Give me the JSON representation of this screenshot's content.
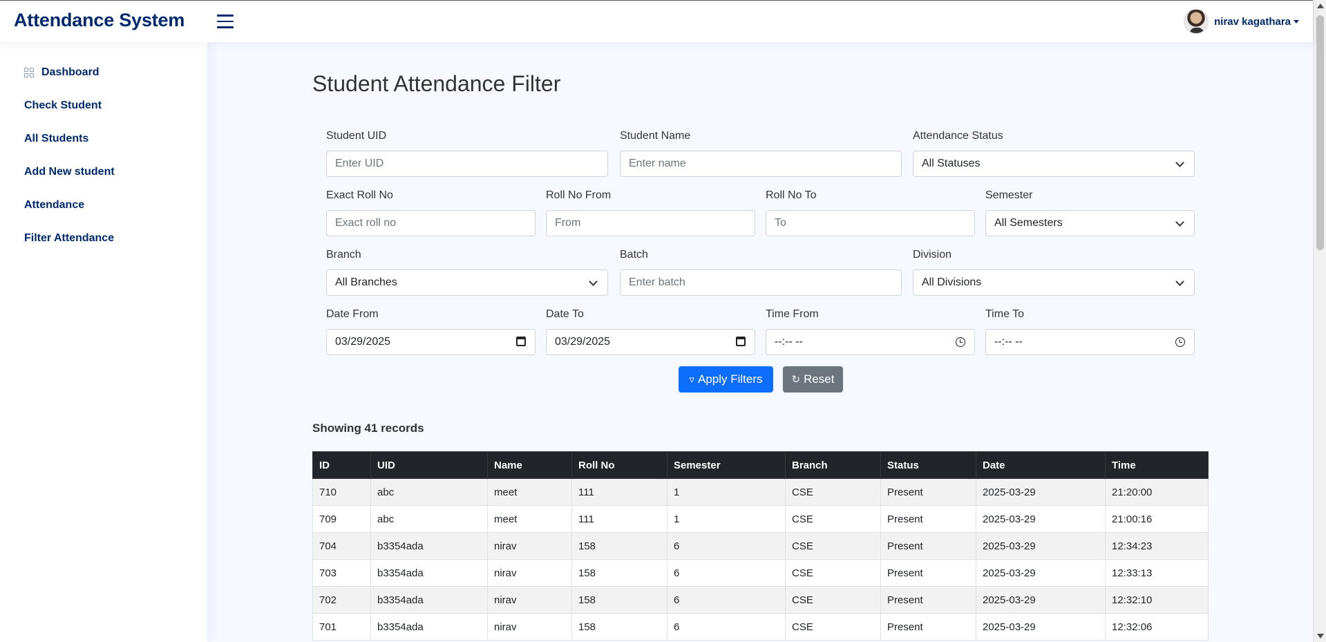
{
  "header": {
    "brand": "Attendance System",
    "user_name": "nirav kagathara"
  },
  "sidebar": {
    "items": [
      {
        "label": "Dashboard",
        "icon": "grid-icon"
      },
      {
        "label": "Check Student"
      },
      {
        "label": "All Students"
      },
      {
        "label": "Add New student"
      },
      {
        "label": "Attendance"
      },
      {
        "label": "Filter Attendance"
      }
    ]
  },
  "main": {
    "title": "Student Attendance Filter",
    "filters": {
      "uid": {
        "label": "Student UID",
        "placeholder": "Enter UID"
      },
      "name": {
        "label": "Student Name",
        "placeholder": "Enter name"
      },
      "status": {
        "label": "Attendance Status",
        "value": "All Statuses"
      },
      "exact_roll": {
        "label": "Exact Roll No",
        "placeholder": "Exact roll no"
      },
      "roll_from": {
        "label": "Roll No From",
        "placeholder": "From"
      },
      "roll_to": {
        "label": "Roll No To",
        "placeholder": "To"
      },
      "semester": {
        "label": "Semester",
        "value": "All Semesters"
      },
      "branch": {
        "label": "Branch",
        "value": "All Branches"
      },
      "batch": {
        "label": "Batch",
        "placeholder": "Enter batch"
      },
      "division": {
        "label": "Division",
        "value": "All Divisions"
      },
      "date_from": {
        "label": "Date From",
        "value": "03/29/2025"
      },
      "date_to": {
        "label": "Date To",
        "value": "03/29/2025"
      },
      "time_from": {
        "label": "Time From",
        "value": "--:-- --"
      },
      "time_to": {
        "label": "Time To",
        "value": "--:-- --"
      }
    },
    "apply_label": "Apply Filters",
    "reset_label": "Reset",
    "records_text": "Showing 41 records",
    "table": {
      "columns": [
        "ID",
        "UID",
        "Name",
        "Roll No",
        "Semester",
        "Branch",
        "Status",
        "Date",
        "Time"
      ],
      "rows": [
        [
          "710",
          "abc",
          "meet",
          "111",
          "1",
          "CSE",
          "Present",
          "2025-03-29",
          "21:20:00"
        ],
        [
          "709",
          "abc",
          "meet",
          "111",
          "1",
          "CSE",
          "Present",
          "2025-03-29",
          "21:00:16"
        ],
        [
          "704",
          "b3354ada",
          "nirav",
          "158",
          "6",
          "CSE",
          "Present",
          "2025-03-29",
          "12:34:23"
        ],
        [
          "703",
          "b3354ada",
          "nirav",
          "158",
          "6",
          "CSE",
          "Present",
          "2025-03-29",
          "12:33:13"
        ],
        [
          "702",
          "b3354ada",
          "nirav",
          "158",
          "6",
          "CSE",
          "Present",
          "2025-03-29",
          "12:32:10"
        ],
        [
          "701",
          "b3354ada",
          "nirav",
          "158",
          "6",
          "CSE",
          "Present",
          "2025-03-29",
          "12:32:06"
        ]
      ]
    }
  },
  "colors": {
    "brand": "#012970",
    "primary": "#0d6efd",
    "secondary": "#6c757d",
    "table_header": "#212529"
  }
}
